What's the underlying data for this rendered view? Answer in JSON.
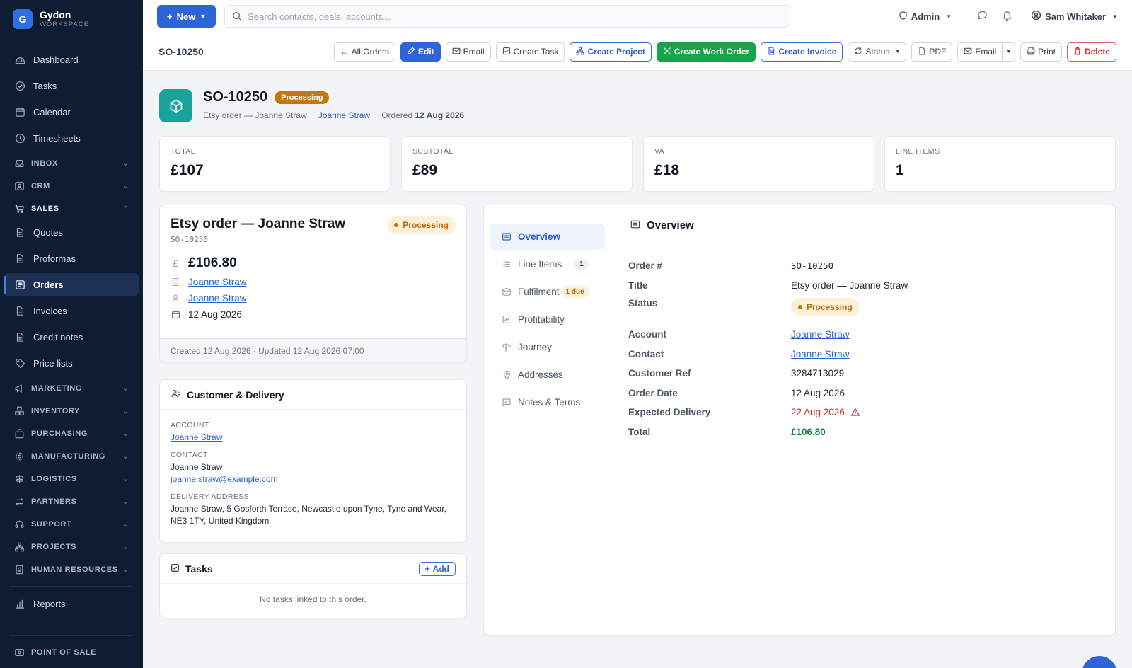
{
  "brand": {
    "initial": "G",
    "name": "Gydon",
    "sub": "WORKSPACE"
  },
  "nav": {
    "dashboard": "Dashboard",
    "tasks": "Tasks",
    "calendar": "Calendar",
    "timesheets": "Timesheets",
    "inbox": "INBOX",
    "crm": "CRM",
    "sales": "SALES",
    "quotes": "Quotes",
    "proformas": "Proformas",
    "orders": "Orders",
    "invoices": "Invoices",
    "credit_notes": "Credit notes",
    "price_lists": "Price lists",
    "marketing": "MARKETING",
    "inventory": "INVENTORY",
    "purchasing": "PURCHASING",
    "manufacturing": "MANUFACTURING",
    "logistics": "LOGISTICS",
    "partners": "PARTNERS",
    "support": "SUPPORT",
    "projects": "PROJECTS",
    "human_resources": "HUMAN RESOURCES",
    "reports": "Reports",
    "point_of_sale": "POINT OF SALE"
  },
  "topbar": {
    "new_label": "New",
    "search_placeholder": "Search contacts, deals, accounts...",
    "admin_label": "Admin",
    "user_name": "Sam Whitaker"
  },
  "actionbar": {
    "code": "SO-10250",
    "all_orders": "All Orders",
    "edit": "Edit",
    "email": "Email",
    "create_task": "Create Task",
    "create_project": "Create Project",
    "create_work_order": "Create Work Order",
    "create_invoice": "Create Invoice",
    "status": "Status",
    "pdf": "PDF",
    "email2": "Email",
    "print": "Print",
    "delete": "Delete"
  },
  "header": {
    "code": "SO-10250",
    "status": "Processing",
    "subtitle": "Etsy order — Joanne Straw",
    "contact": "Joanne Straw",
    "ordered_prefix": "Ordered",
    "ordered_date": "12 Aug 2026"
  },
  "stats": [
    {
      "label": "TOTAL",
      "value": "£107"
    },
    {
      "label": "SUBTOTAL",
      "value": "£89"
    },
    {
      "label": "VAT",
      "value": "£18"
    },
    {
      "label": "LINE ITEMS",
      "value": "1"
    }
  ],
  "summary": {
    "title": "Etsy order — Joanne Straw",
    "code": "SO-10250",
    "status": "Processing",
    "currency_symbol": "£",
    "amount": "£106.80",
    "account": "Joanne Straw",
    "contact": "Joanne Straw",
    "date": "12 Aug 2026",
    "footer": "Created 12 Aug 2026 · Updated 12 Aug 2026 07:00"
  },
  "customer": {
    "title": "Customer & Delivery",
    "account_label": "ACCOUNT",
    "account": "Joanne Straw",
    "contact_label": "CONTACT",
    "contact_name": "Joanne Straw",
    "contact_email": "joanne.straw@example.com",
    "delivery_label": "DELIVERY ADDRESS",
    "delivery_line1": "Joanne Straw, 5 Gosforth Terrace, Newcastle upon Tyne, Tyne and Wear,",
    "delivery_line2": "NE3 1TY, United Kingdom"
  },
  "tasks": {
    "title": "Tasks",
    "add_label": "Add",
    "empty": "No tasks linked to this order."
  },
  "tabs": {
    "overview": "Overview",
    "line_items": "Line Items",
    "line_items_count": "1",
    "fulfilment": "Fulfilment",
    "fulfilment_badge": "1 due",
    "profitability": "Profitability",
    "journey": "Journey",
    "addresses": "Addresses",
    "notes_terms": "Notes & Terms"
  },
  "overview": {
    "title": "Overview",
    "order_no_label": "Order #",
    "order_no": "SO-10250",
    "title_label": "Title",
    "title_value": "Etsy order — Joanne Straw",
    "status_label": "Status",
    "status_value": "Processing",
    "account_label": "Account",
    "account_value": "Joanne Straw",
    "contact_label": "Contact",
    "contact_value": "Joanne Straw",
    "customer_ref_label": "Customer Ref",
    "customer_ref": "3284713029",
    "order_date_label": "Order Date",
    "order_date": "12 Aug 2026",
    "expected_delivery_label": "Expected Delivery",
    "expected_delivery": "22 Aug 2026",
    "total_label": "Total",
    "total": "£106.80"
  },
  "colors": {
    "primary": "#2f63d8",
    "sidebar": "#0f1d33",
    "green": "#16a34a",
    "amber": "#c2780e",
    "danger": "#dc2626"
  }
}
